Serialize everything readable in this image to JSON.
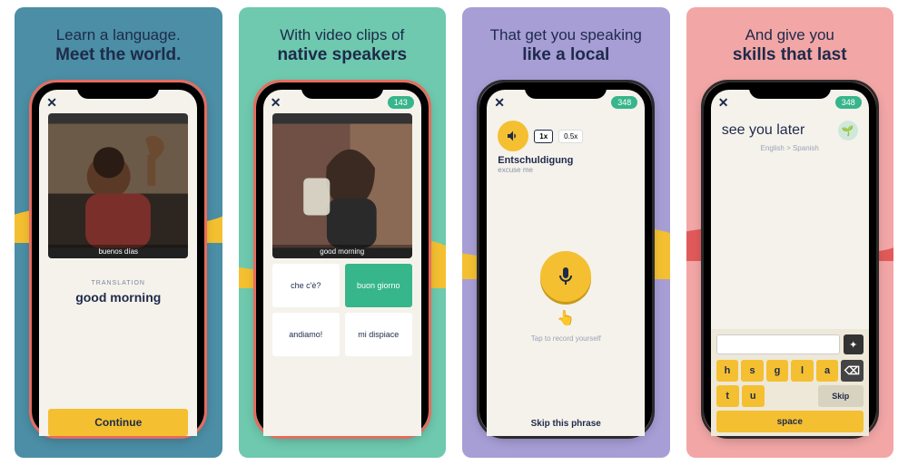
{
  "panels": [
    {
      "headline_line1": "Learn a language.",
      "headline_line2": "Meet the world.",
      "bg": "#4b8ea5",
      "phone_color": "#e86a5e",
      "caption": "buenos días",
      "translation_label": "TRANSLATION",
      "translation_text": "good morning",
      "continue_label": "Continue"
    },
    {
      "headline_line1": "With video clips of",
      "headline_line2": "native speakers",
      "bg": "#6ec9ae",
      "phone_color": "#e86a5e",
      "badge": "143",
      "caption": "good morning",
      "options": [
        "che c'è?",
        "buon giorno",
        "andiamo!",
        "mi dispiace"
      ],
      "selected_index": 1
    },
    {
      "headline_line1": "That get you speaking",
      "headline_line2": "like a local",
      "bg": "#a79ed6",
      "phone_color": "#2b2b2b",
      "badge": "348",
      "speeds": [
        "1x",
        "0.5x"
      ],
      "active_speed_index": 0,
      "word": "Entschuldigung",
      "word_sub": "excuse me",
      "tap_hint": "Tap to record yourself",
      "hand_emoji": "👆",
      "skip_label": "Skip this phrase"
    },
    {
      "headline_line1": "And give you",
      "headline_line2": "skills that last",
      "bg": "#f2a6a6",
      "phone_color": "#2b2b2b",
      "badge": "348",
      "prompt": "see you later",
      "lang_sub": "English > Spanish",
      "lang_emoji": "🌱",
      "keys_row1": [
        "h",
        "s",
        "g",
        "l",
        "a",
        "t",
        "u"
      ],
      "backspace": "⌫",
      "skip_key": "Skip",
      "space_key": "space",
      "wand": "✦"
    }
  ],
  "icons": {
    "close": "✕",
    "speaker": "🔊",
    "mic": "🎤"
  }
}
